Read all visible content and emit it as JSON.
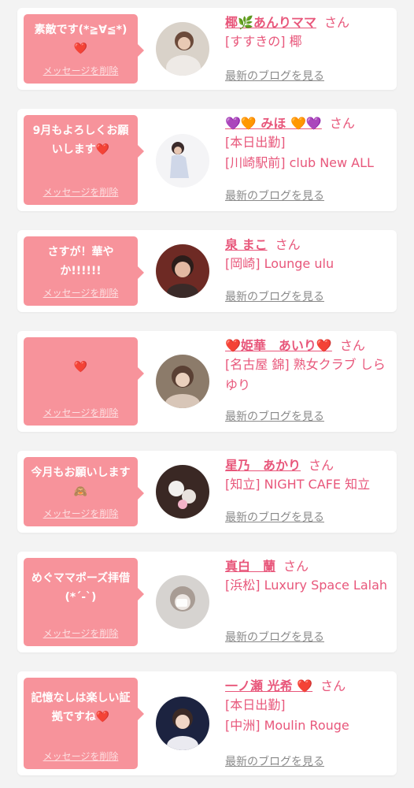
{
  "colors": {
    "accent": "#e8577b",
    "bubble": "#f7939b",
    "card": "#ffffff",
    "background": "#f3f3f3",
    "link_gray": "#8a8a8a"
  },
  "common": {
    "delete_label": "メッセージを削除",
    "blog_link": "最新のブログを見る",
    "honorific": "さん"
  },
  "cards": [
    {
      "message": "素敵です(*≧∀≦*)❤️",
      "name": "椰🌿あんりママ",
      "shop_lines": [
        "[すすきの] 椰"
      ],
      "avatar": "woman-photo-white-outfit"
    },
    {
      "message": "9月もよろしくお願いします❤️",
      "name": "💜🧡 みほ 🧡💜",
      "shop_lines": [
        "[本日出勤]",
        "[川崎駅前] club New ALL"
      ],
      "avatar": "woman-photo-white-dress"
    },
    {
      "message": "さすが！華やか!!!!!!",
      "name": "泉 まこ",
      "shop_lines": [
        "[岡崎] Lounge ulu"
      ],
      "avatar": "woman-photo-red-background"
    },
    {
      "message": "❤️",
      "name": "❤️姫華　あいり❤️",
      "shop_lines": [
        "[名古屋 錦] 熟女クラブ しらゆり"
      ],
      "avatar": "woman-photo-dim-lights"
    },
    {
      "message": "今月もお願いします🙈",
      "name": "星乃　あかり",
      "shop_lines": [
        "[知立] NIGHT CAFE 知立"
      ],
      "avatar": "flower-photo"
    },
    {
      "message": "めぐママポーズ拝借(*´-`)",
      "name": "真白　蘭",
      "shop_lines": [
        "[浜松] Luxury Space Lalah"
      ],
      "avatar": "blurred-face-photo"
    },
    {
      "message": "記憶なしは楽しい証拠ですね❤️",
      "name": "一ノ瀬 光希 ❤️",
      "shop_lines": [
        "[本日出勤]",
        "[中洲] Moulin Rouge"
      ],
      "avatar": "woman-photo-night"
    }
  ]
}
